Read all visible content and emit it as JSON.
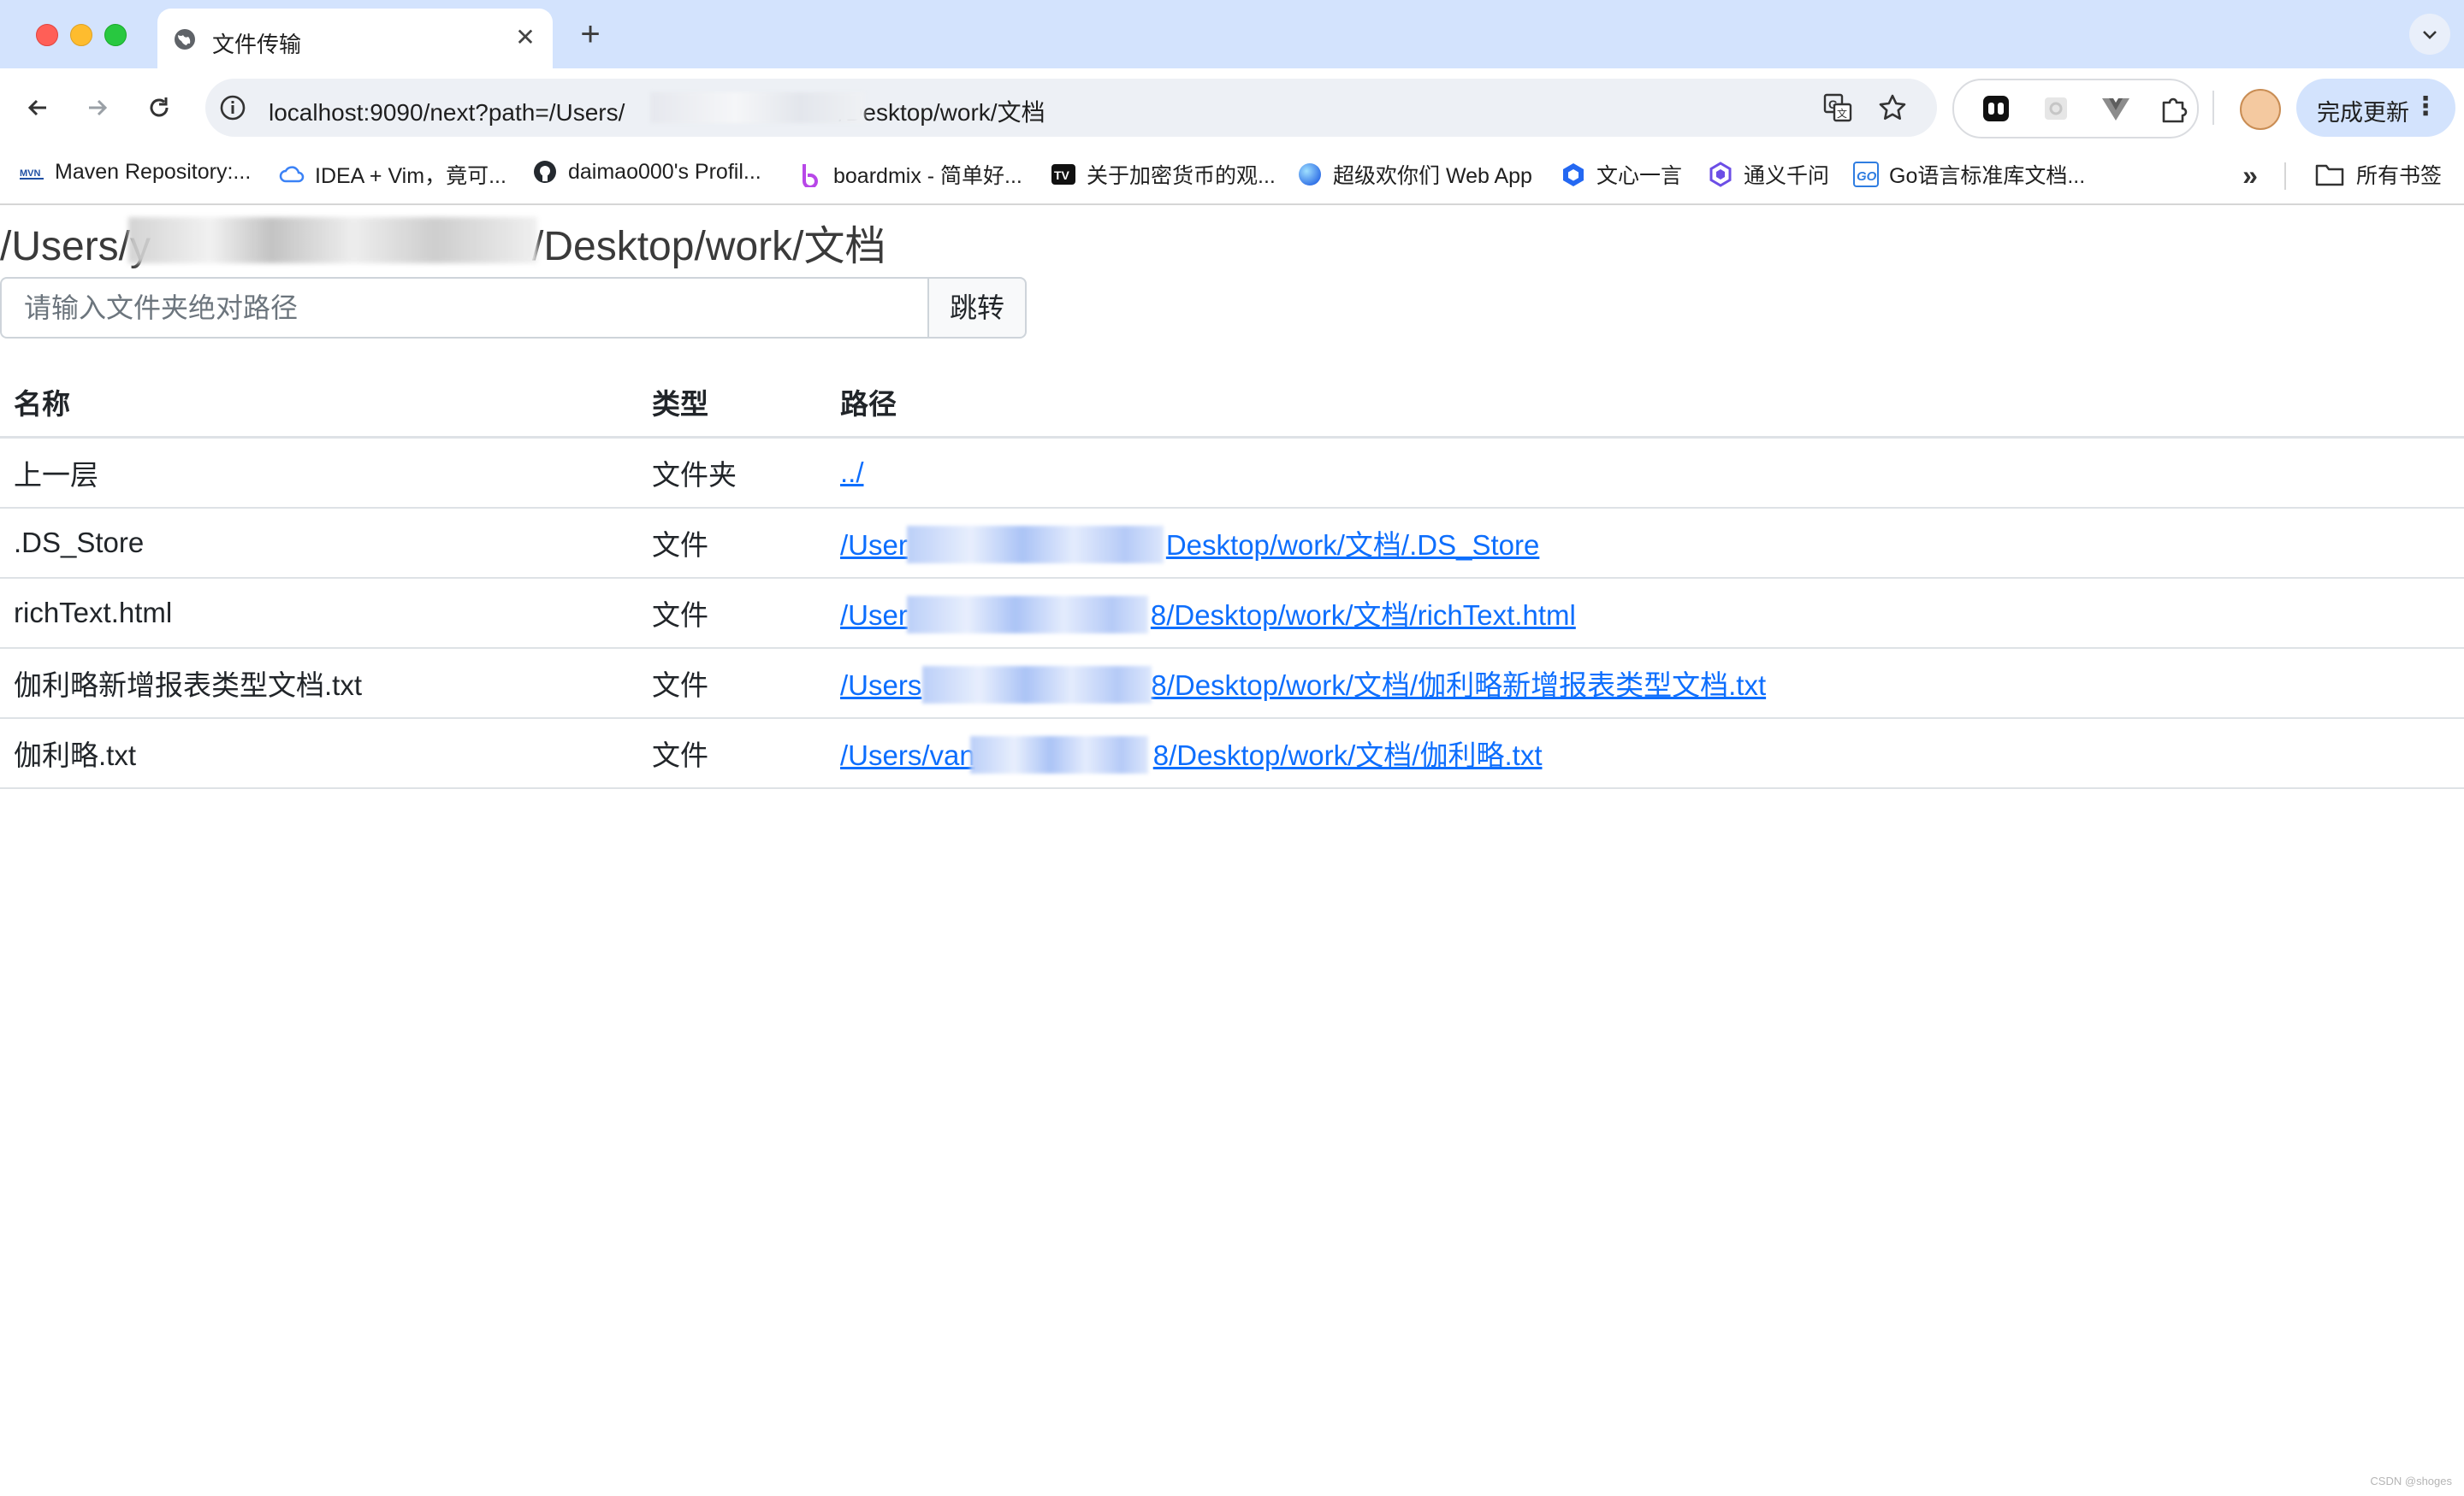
{
  "browser": {
    "tab_title": "文件传输",
    "url": "localhost:9090/next?path=/Users/",
    "url_suffix": "/Desktop/work/文档",
    "update_button": "完成更新",
    "bookmarks": [
      {
        "label": "Maven Repository:...",
        "icon": "maven-icon"
      },
      {
        "label": "IDEA + Vim，竟可...",
        "icon": "cloud-icon"
      },
      {
        "label": "daimao000's Profil...",
        "icon": "github-icon"
      },
      {
        "label": "boardmix - 简单好...",
        "icon": "boardmix-icon"
      },
      {
        "label": "关于加密货币的观...",
        "icon": "tv-icon"
      },
      {
        "label": "超级欢你们 Web App",
        "icon": "sphere-icon"
      },
      {
        "label": "文心一言",
        "icon": "cube-icon"
      },
      {
        "label": "通义千问",
        "icon": "tongyi-icon"
      },
      {
        "label": "Go语言标准库文档...",
        "icon": "go-icon"
      }
    ],
    "all_bookmarks": "所有书签"
  },
  "page": {
    "title_prefix": "/Users/y",
    "title_suffix": "/Desktop/work/文档",
    "search": {
      "placeholder": "请输入文件夹绝对路径",
      "button": "跳转"
    },
    "table": {
      "headers": [
        "名称",
        "类型",
        "路径"
      ],
      "rows": [
        {
          "name": "上一层",
          "type": "文件夹",
          "path": "../"
        },
        {
          "name": ".DS_Store",
          "type": "文件",
          "path_prefix": "/User",
          "path_suffix": "Desktop/work/文档/.DS_Store"
        },
        {
          "name": "richText.html",
          "type": "文件",
          "path_prefix": "/User",
          "path_suffix": "8/Desktop/work/文档/richText.html"
        },
        {
          "name": "伽利略新增报表类型文档.txt",
          "type": "文件",
          "path_prefix": "/Users",
          "path_suffix": "8/Desktop/work/文档/伽利略新增报表类型文档.txt"
        },
        {
          "name": "伽利略.txt",
          "type": "文件",
          "path_prefix": "/Users/van",
          "path_suffix": "8/Desktop/work/文档/伽利略.txt"
        }
      ]
    }
  },
  "watermark": "CSDN @shoges"
}
